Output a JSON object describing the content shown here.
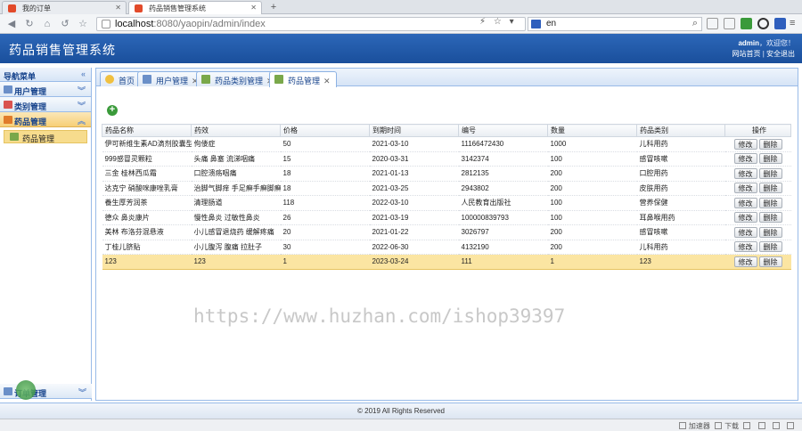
{
  "browser": {
    "tabs": [
      {
        "label": "我的订单"
      },
      {
        "label": "药品销售管理系统"
      }
    ],
    "new_tab": "+",
    "url_host": "localhost",
    "url_path": ":8080/yaopin/admin/index",
    "search_value": "en"
  },
  "header": {
    "title": "药品销售管理系统",
    "user": "admin",
    "welcome": "，欢迎您！",
    "home_link": "网站首页",
    "logout_link": "安全退出"
  },
  "sidebar": {
    "title": "导航菜单",
    "groups": [
      {
        "label": "用户管理"
      },
      {
        "label": "类别管理"
      },
      {
        "label": "药品管理"
      }
    ],
    "sub_items": [
      {
        "label": "药品管理"
      }
    ],
    "bottom_group": {
      "label": "订单管理"
    }
  },
  "page_tabs": [
    {
      "label": "首页"
    },
    {
      "label": "用户管理"
    },
    {
      "label": "药品类别管理"
    },
    {
      "label": "药品管理"
    }
  ],
  "table": {
    "columns": [
      "药品名称",
      "药效",
      "价格",
      "到期时间",
      "编号",
      "数量",
      "药品类别",
      "操作"
    ],
    "edit_label": "修改",
    "delete_label": "删除",
    "rows": [
      [
        "伊可新维生素AD滴剂胶囊型",
        "佝偻症",
        "50",
        "2021-03-10",
        "11166472430",
        "1000",
        "儿科用药"
      ],
      [
        "999感冒灵颗粒",
        "头痛 鼻塞 流涕咽痛",
        "15",
        "2020-03-31",
        "3142374",
        "100",
        "感冒咳嗽"
      ],
      [
        "三金 桂林西瓜霜",
        "口腔溃疡咽痛",
        "18",
        "2021-01-13",
        "2812135",
        "200",
        "口腔用药"
      ],
      [
        "达克宁 硝酸咪康唑乳膏",
        "治脚气脚痒 手足癣手癣脚癣",
        "18",
        "2021-03-25",
        "2943802",
        "200",
        "皮肤用药"
      ],
      [
        "養生厚芳润茶",
        "清理肠道",
        "118",
        "2022-03-10",
        "人民教育出版社",
        "100",
        "营养保健"
      ],
      [
        "德众 鼻炎康片",
        "慢性鼻炎 过敏性鼻炎",
        "26",
        "2021-03-19",
        "100000839793",
        "100",
        "耳鼻喉用药"
      ],
      [
        "美林 布洛芬混悬液",
        "小儿感冒退烧药 缓解疼痛",
        "20",
        "2021-01-22",
        "3026797",
        "200",
        "感冒咳嗽"
      ],
      [
        "丁桂儿脐贴",
        "小儿腹泻 腹痛 拉肚子",
        "30",
        "2022-06-30",
        "4132190",
        "200",
        "儿科用药"
      ],
      [
        "123",
        "123",
        "1",
        "2023-03-24",
        "111",
        "1",
        "123"
      ]
    ]
  },
  "watermark": "https://www.huzhan.com/ishop39397",
  "footer": "© 2019 All Rights Reserved",
  "statusbar": {
    "items": [
      "加速器",
      "下载"
    ]
  }
}
